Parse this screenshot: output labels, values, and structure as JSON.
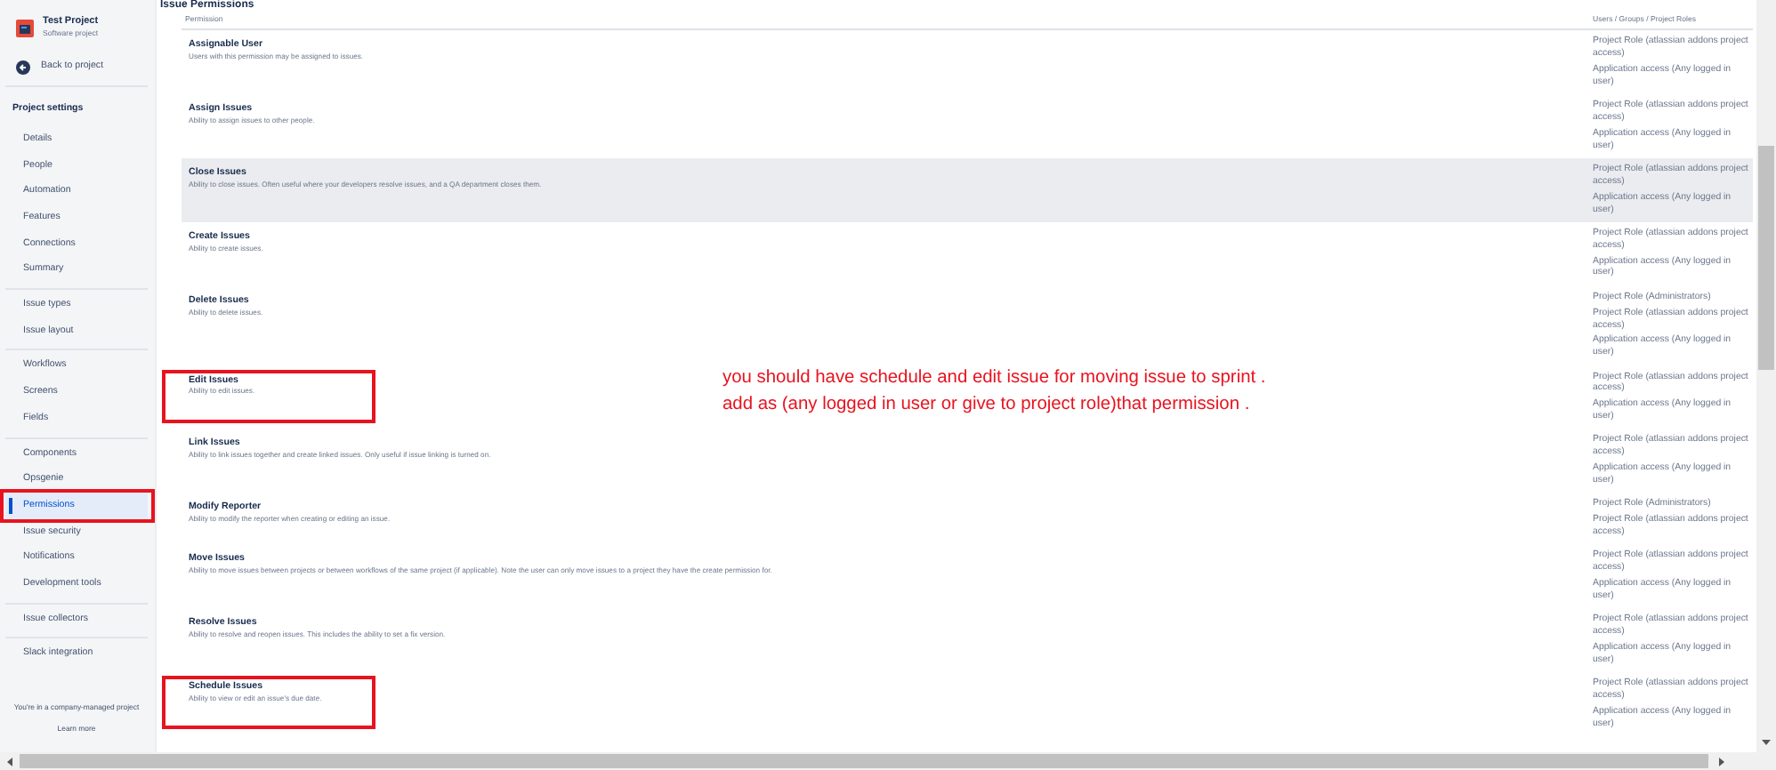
{
  "sidebar": {
    "project": {
      "name": "Test Project",
      "type": "Software project"
    },
    "back_link": "Back to project",
    "heading": "Project settings",
    "groups": [
      [
        {
          "label": "Details",
          "selected": false,
          "boxed": false
        },
        {
          "label": "People",
          "selected": false,
          "boxed": false
        },
        {
          "label": "Automation",
          "selected": false,
          "boxed": false
        },
        {
          "label": "Features",
          "selected": false,
          "boxed": false
        },
        {
          "label": "Connections",
          "selected": false,
          "boxed": false
        },
        {
          "label": "Summary",
          "selected": false,
          "boxed": false
        }
      ],
      [
        {
          "label": "Issue types",
          "selected": false,
          "boxed": false
        },
        {
          "label": "Issue layout",
          "selected": false,
          "boxed": false
        }
      ],
      [
        {
          "label": "Workflows",
          "selected": false,
          "boxed": false
        },
        {
          "label": "Screens",
          "selected": false,
          "boxed": false
        },
        {
          "label": "Fields",
          "selected": false,
          "boxed": false
        }
      ],
      [
        {
          "label": "Components",
          "selected": false,
          "boxed": false
        },
        {
          "label": "Opsgenie",
          "selected": false,
          "boxed": false
        },
        {
          "label": "Permissions",
          "selected": true,
          "boxed": true
        },
        {
          "label": "Issue security",
          "selected": false,
          "boxed": false
        },
        {
          "label": "Notifications",
          "selected": false,
          "boxed": false
        },
        {
          "label": "Development tools",
          "selected": false,
          "boxed": false
        }
      ],
      [
        {
          "label": "Issue collectors",
          "selected": false,
          "boxed": false
        }
      ],
      [
        {
          "label": "Slack integration",
          "selected": false,
          "boxed": false
        }
      ]
    ],
    "footer": {
      "text": "You're in a company-managed project",
      "link": "Learn more"
    }
  },
  "section_title": "Issue Permissions",
  "table": {
    "columns": [
      "Permission",
      "Users / Groups / Project Roles"
    ],
    "rows": [
      {
        "name": "Assignable User",
        "description": "Users with this permission may be assigned to issues.",
        "roles": [
          "Project Role (atlassian addons project access)",
          "Application access (Any logged in user)"
        ],
        "highlighted": false,
        "boxed": false
      },
      {
        "name": "Assign Issues",
        "description": "Ability to assign issues to other people.",
        "roles": [
          "Project Role (atlassian addons project access)",
          "Application access (Any logged in user)"
        ],
        "highlighted": false,
        "boxed": false
      },
      {
        "name": "Close Issues",
        "description": "Ability to close issues. Often useful where your developers resolve issues, and a QA department closes them.",
        "roles": [
          "Project Role (atlassian addons project access)",
          "Application access (Any logged in user)"
        ],
        "highlighted": true,
        "boxed": false
      },
      {
        "name": "Create Issues",
        "description": "Ability to create issues.",
        "roles": [
          "Project Role (atlassian addons project access)",
          "Application access (Any logged in user)"
        ],
        "highlighted": false,
        "boxed": false
      },
      {
        "name": "Delete Issues",
        "description": "Ability to delete issues.",
        "roles": [
          "Project Role (Administrators)",
          "Project Role (atlassian addons project access)",
          "Application access (Any logged in user)"
        ],
        "highlighted": false,
        "boxed": false
      },
      {
        "name": "Edit Issues",
        "description": "Ability to edit issues.",
        "roles": [
          "Project Role (atlassian addons project access)",
          "Application access (Any logged in user)"
        ],
        "highlighted": false,
        "boxed": true
      },
      {
        "name": "Link Issues",
        "description": "Ability to link issues together and create linked issues. Only useful if issue linking is turned on.",
        "roles": [
          "Project Role (atlassian addons project access)",
          "Application access (Any logged in user)"
        ],
        "highlighted": false,
        "boxed": false
      },
      {
        "name": "Modify Reporter",
        "description": "Ability to modify the reporter when creating or editing an issue.",
        "roles": [
          "Project Role (Administrators)",
          "Project Role (atlassian addons project access)"
        ],
        "highlighted": false,
        "boxed": false
      },
      {
        "name": "Move Issues",
        "description": "Ability to move issues between projects or between workflows of the same project (if applicable). Note the user can only move issues to a project they have the create permission for.",
        "roles": [
          "Project Role (atlassian addons project access)",
          "Application access (Any logged in user)"
        ],
        "highlighted": false,
        "boxed": false
      },
      {
        "name": "Resolve Issues",
        "description": "Ability to resolve and reopen issues. This includes the ability to set a fix version.",
        "roles": [
          "Project Role (atlassian addons project access)",
          "Application access (Any logged in user)"
        ],
        "highlighted": false,
        "boxed": false
      },
      {
        "name": "Schedule Issues",
        "description": "Ability to view or edit an issue's due date.",
        "roles": [
          "Project Role (atlassian addons project access)",
          "Application access (Any logged in user)"
        ],
        "highlighted": false,
        "boxed": true
      }
    ]
  },
  "annotation": [
    "you should have schedule and edit issue for moving issue to sprint .",
    "add as (any logged in user or give to project role)that permission ."
  ]
}
